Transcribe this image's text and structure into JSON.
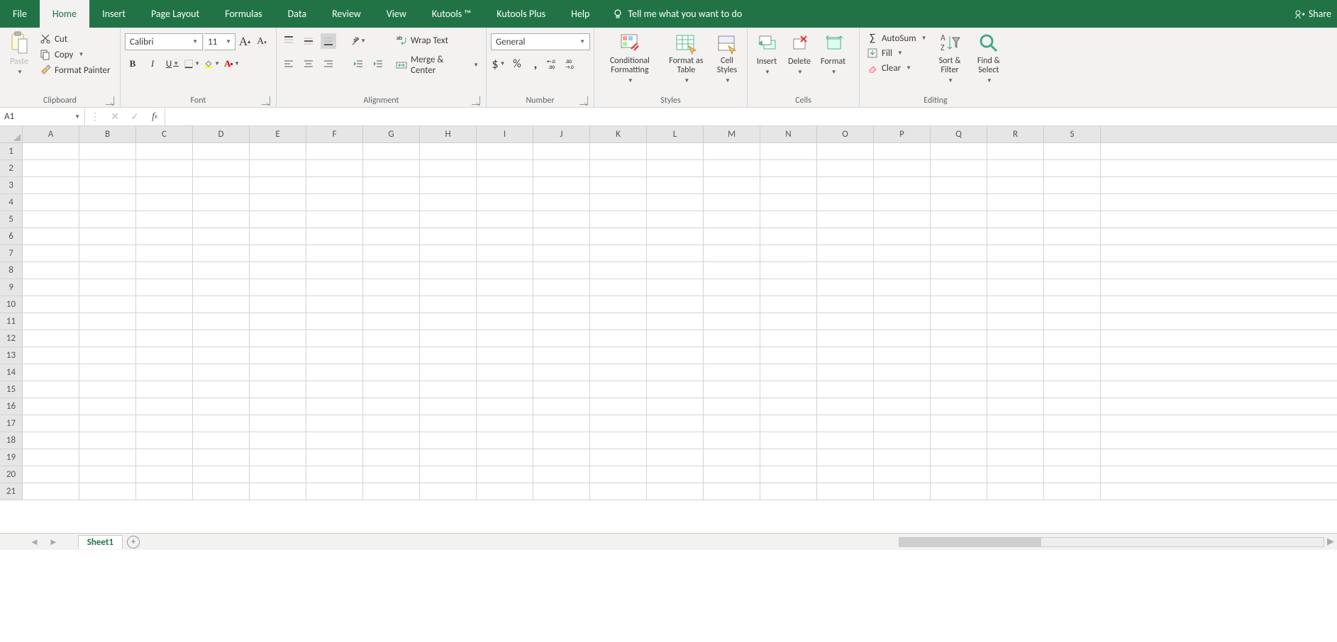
{
  "tabs": {
    "file": "File",
    "home": "Home",
    "insert": "Insert",
    "page_layout": "Page Layout",
    "formulas": "Formulas",
    "data": "Data",
    "review": "Review",
    "view": "View",
    "kutools": "Kutools ™",
    "kutools_plus": "Kutools Plus",
    "help": "Help",
    "tellme": "Tell me what you want to do",
    "share": "Share"
  },
  "clipboard": {
    "paste": "Paste",
    "cut": "Cut",
    "copy": "Copy",
    "format_painter": "Format Painter",
    "label": "Clipboard"
  },
  "font": {
    "name": "Calibri",
    "size": "11",
    "bold": "B",
    "italic": "I",
    "underline": "U",
    "label": "Font"
  },
  "alignment": {
    "wrap_text": "Wrap Text",
    "merge_center": "Merge & Center",
    "label": "Alignment"
  },
  "number": {
    "format": "General",
    "label": "Number"
  },
  "styles": {
    "conditional": "Conditional Formatting",
    "format_table": "Format as Table",
    "cell_styles": "Cell Styles",
    "label": "Styles"
  },
  "cells": {
    "insert": "Insert",
    "delete": "Delete",
    "format": "Format",
    "label": "Cells"
  },
  "editing": {
    "autosum": "AutoSum",
    "fill": "Fill",
    "clear": "Clear",
    "sort_filter": "Sort & Filter",
    "find_select": "Find & Select",
    "label": "Editing"
  },
  "fx": {
    "namebox": "A1"
  },
  "grid": {
    "cols": [
      "A",
      "B",
      "C",
      "D",
      "E",
      "F",
      "G",
      "H",
      "I",
      "J",
      "K",
      "L",
      "M",
      "N",
      "O",
      "P",
      "Q",
      "R",
      "S"
    ],
    "rows": [
      "1",
      "2",
      "3",
      "4",
      "5",
      "6",
      "7",
      "8",
      "9",
      "10",
      "11",
      "12",
      "13",
      "14",
      "15",
      "16",
      "17",
      "18",
      "19",
      "20",
      "21"
    ]
  },
  "sheet": {
    "name": "Sheet1"
  }
}
